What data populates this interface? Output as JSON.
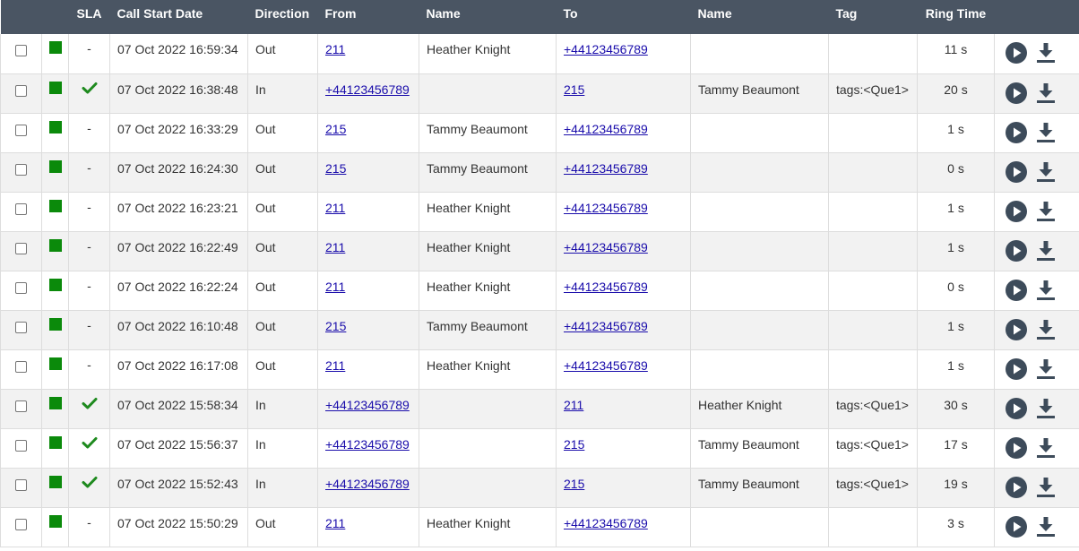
{
  "headers": {
    "sla": "SLA",
    "start_date": "Call Start Date",
    "direction": "Direction",
    "from": "From",
    "from_name": "Name",
    "to": "To",
    "to_name": "Name",
    "tag": "Tag",
    "ring_time": "Ring Time"
  },
  "colors": {
    "header_bg": "#4a5563",
    "status_green": "#0b8a0b",
    "sla_check": "#1e8a1e",
    "icon": "#3d4b5a",
    "link": "#1a0dab"
  },
  "rows": [
    {
      "sla": "-",
      "date": "07 Oct 2022 16:59:34",
      "direction": "Out",
      "from": "211",
      "from_name": "Heather Knight",
      "to": "+44123456789",
      "to_name": "",
      "tag": "",
      "ring": "11 s"
    },
    {
      "sla": "check",
      "date": "07 Oct 2022 16:38:48",
      "direction": "In",
      "from": "+44123456789",
      "from_name": "",
      "to": "215",
      "to_name": "Tammy Beaumont",
      "tag": "tags:<Que1>",
      "ring": "20 s"
    },
    {
      "sla": "-",
      "date": "07 Oct 2022 16:33:29",
      "direction": "Out",
      "from": "215",
      "from_name": "Tammy Beaumont",
      "to": "+44123456789",
      "to_name": "",
      "tag": "",
      "ring": "1 s"
    },
    {
      "sla": "-",
      "date": "07 Oct 2022 16:24:30",
      "direction": "Out",
      "from": "215",
      "from_name": "Tammy Beaumont",
      "to": "+44123456789",
      "to_name": "",
      "tag": "",
      "ring": "0 s"
    },
    {
      "sla": "-",
      "date": "07 Oct 2022 16:23:21",
      "direction": "Out",
      "from": "211",
      "from_name": "Heather Knight",
      "to": "+44123456789",
      "to_name": "",
      "tag": "",
      "ring": "1 s"
    },
    {
      "sla": "-",
      "date": "07 Oct 2022 16:22:49",
      "direction": "Out",
      "from": "211",
      "from_name": "Heather Knight",
      "to": "+44123456789",
      "to_name": "",
      "tag": "",
      "ring": "1 s"
    },
    {
      "sla": "-",
      "date": "07 Oct 2022 16:22:24",
      "direction": "Out",
      "from": "211",
      "from_name": "Heather Knight",
      "to": "+44123456789",
      "to_name": "",
      "tag": "",
      "ring": "0 s"
    },
    {
      "sla": "-",
      "date": "07 Oct 2022 16:10:48",
      "direction": "Out",
      "from": "215",
      "from_name": "Tammy Beaumont",
      "to": "+44123456789",
      "to_name": "",
      "tag": "",
      "ring": "1 s"
    },
    {
      "sla": "-",
      "date": "07 Oct 2022 16:17:08",
      "direction": "Out",
      "from": "211",
      "from_name": "Heather Knight",
      "to": "+44123456789",
      "to_name": "",
      "tag": "",
      "ring": "1 s"
    },
    {
      "sla": "check",
      "date": "07 Oct 2022 15:58:34",
      "direction": "In",
      "from": "+44123456789",
      "from_name": "",
      "to": "211",
      "to_name": "Heather Knight",
      "tag": "tags:<Que1>",
      "ring": "30 s"
    },
    {
      "sla": "check",
      "date": "07 Oct 2022 15:56:37",
      "direction": "In",
      "from": "+44123456789",
      "from_name": "",
      "to": "215",
      "to_name": "Tammy Beaumont",
      "tag": "tags:<Que1>",
      "ring": "17 s"
    },
    {
      "sla": "check",
      "date": "07 Oct 2022 15:52:43",
      "direction": "In",
      "from": "+44123456789",
      "from_name": "",
      "to": "215",
      "to_name": "Tammy Beaumont",
      "tag": "tags:<Que1>",
      "ring": "19 s"
    },
    {
      "sla": "-",
      "date": "07 Oct 2022 15:50:29",
      "direction": "Out",
      "from": "211",
      "from_name": "Heather Knight",
      "to": "+44123456789",
      "to_name": "",
      "tag": "",
      "ring": "3 s"
    }
  ]
}
